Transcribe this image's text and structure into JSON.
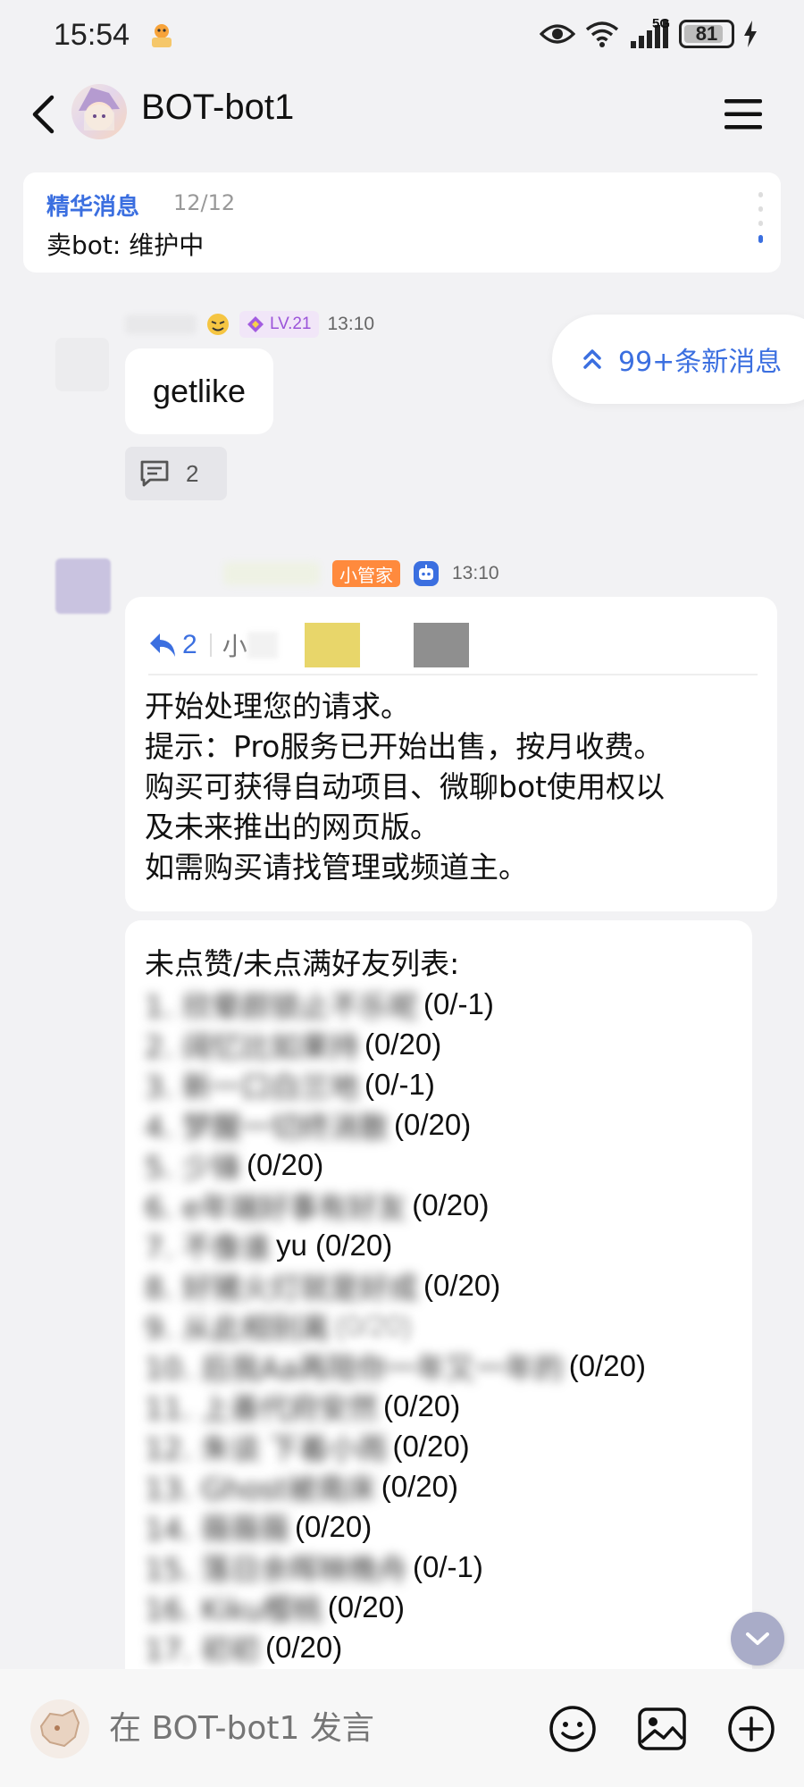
{
  "status_bar": {
    "time": "15:54",
    "network": "5G",
    "battery": "81"
  },
  "header": {
    "title": "BOT-bot1"
  },
  "featured": {
    "label": "精华消息",
    "count": "12/12",
    "text": "卖bot: 维护中"
  },
  "new_messages": {
    "label": "99+条新消息"
  },
  "message1": {
    "level": "LV.21",
    "time": "13:10",
    "text": "getlike",
    "reply_count": "2"
  },
  "message2": {
    "badge": "小管家",
    "time": "13:10",
    "quote_count": "2",
    "quote_partial": "小",
    "lines": [
      "开始处理您的请求。",
      "提示：Pro服务已开始出售，按月收费。",
      "购买可获得自动项目、微聊bot使用权以",
      "及未来推出的网页版。",
      "如需购买请找管理或频道主。"
    ]
  },
  "message3": {
    "header": "未点赞/未点满好友列表:",
    "rows": [
      {
        "name": "1. 欣晕颜锁止不乐呢",
        "value": "(0/-1)"
      },
      {
        "name": "2. 阔忆比如果持",
        "value": "(0/20)"
      },
      {
        "name": "3. 新一口白兰地",
        "value": "(0/-1)"
      },
      {
        "name": "4. 梦醒一切终消散",
        "value": "(0/20)"
      },
      {
        "name": "5. 少锋",
        "value": "(0/20)"
      },
      {
        "name": "6. e年端好事有好友",
        "value": "(0/20)"
      },
      {
        "name": "7. 不像谁",
        "value": "yu (0/20)"
      },
      {
        "name": "8. 好猪火灯就是好成",
        "value": "(0/20)"
      },
      {
        "name": "9. 从此相别离",
        "value": "(0/20)"
      },
      {
        "name": "10. 后我Aa再陪你一年又一年的",
        "value": "(0/20)"
      },
      {
        "name": "11. 上善代府安然",
        "value": "(0/20)"
      },
      {
        "name": "12. 朱谈 下着小雨",
        "value": "(0/20)"
      },
      {
        "name": "13. Ghost被南床",
        "value": "(0/20)"
      },
      {
        "name": "14. 薇薇薇",
        "value": "(0/20)"
      },
      {
        "name": "15. 落日余晖映晚舟",
        "value": "(0/-1)"
      },
      {
        "name": "16. Kiku樱桃",
        "value": "(0/20)"
      },
      {
        "name": "17. 初初",
        "value": "(0/20)"
      }
    ]
  },
  "input": {
    "placeholder": "在 BOT-bot1 发言"
  },
  "colors": {
    "accent": "#3b6fe0",
    "badge_orange": "#ff8a3d",
    "level_purple": "#9b54d9"
  },
  "icons": [
    "back-icon",
    "menu-icon",
    "eye-icon",
    "wifi-icon",
    "signal-icon",
    "battery-icon",
    "charging-icon",
    "reply-arrow-icon",
    "comment-icon",
    "double-chevron-up-icon",
    "chevron-down-icon",
    "emoji-icon",
    "image-icon",
    "plus-icon",
    "bot-icon"
  ]
}
